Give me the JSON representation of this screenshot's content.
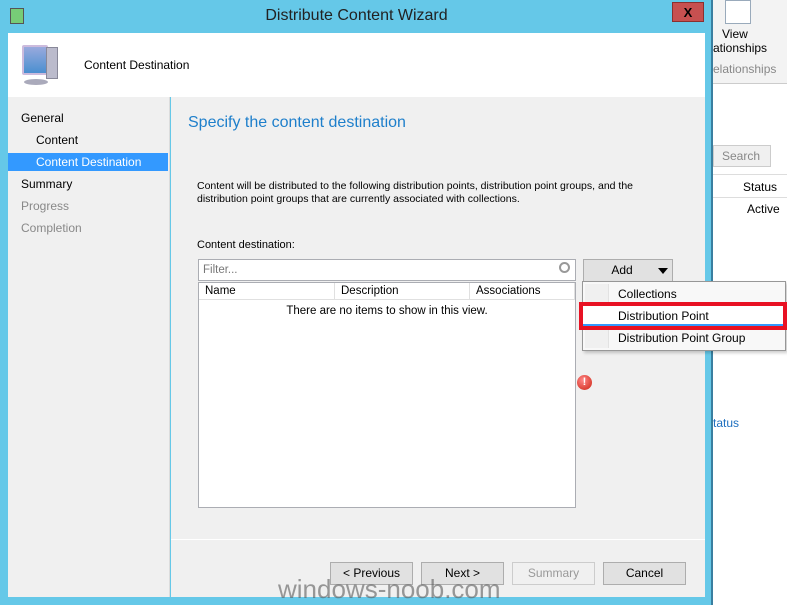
{
  "window": {
    "title": "Distribute Content Wizard",
    "close_label": "X"
  },
  "header": {
    "title": "Content Destination"
  },
  "nav": {
    "items": [
      {
        "label": "General",
        "level": 0,
        "state": "normal"
      },
      {
        "label": "Content",
        "level": 1,
        "state": "normal"
      },
      {
        "label": "Content Destination",
        "level": 1,
        "state": "selected"
      },
      {
        "label": "Summary",
        "level": 0,
        "state": "normal"
      },
      {
        "label": "Progress",
        "level": 0,
        "state": "disabled"
      },
      {
        "label": "Completion",
        "level": 0,
        "state": "disabled"
      }
    ]
  },
  "main": {
    "heading": "Specify the content destination",
    "description": "Content will be distributed to the following distribution points, distribution point groups, and the distribution point groups that are currently associated with collections.",
    "destination_label": "Content destination:",
    "filter_placeholder": "Filter...",
    "columns": [
      "Name",
      "Description",
      "Associations"
    ],
    "empty_text": "There are no items to show in this view.",
    "add_label": "Add"
  },
  "add_menu": {
    "items": [
      "Collections",
      "Distribution Point",
      "Distribution Point Group"
    ],
    "highlighted": "Distribution Point"
  },
  "footer": {
    "previous": "< Previous",
    "next": "Next >",
    "summary": "Summary",
    "cancel": "Cancel"
  },
  "watermark": "windows-noob.com",
  "background_app": {
    "view_label": "View",
    "relationships_label": "ationships",
    "group_label": "elationships",
    "search_label": "Search",
    "status_header": "Status",
    "status_value": "Active",
    "status_link": "tatus"
  },
  "colors": {
    "titlebar": "#65c8e8",
    "selection": "#3399ff",
    "highlight_box": "#e81123",
    "heading": "#1e7fcb"
  }
}
